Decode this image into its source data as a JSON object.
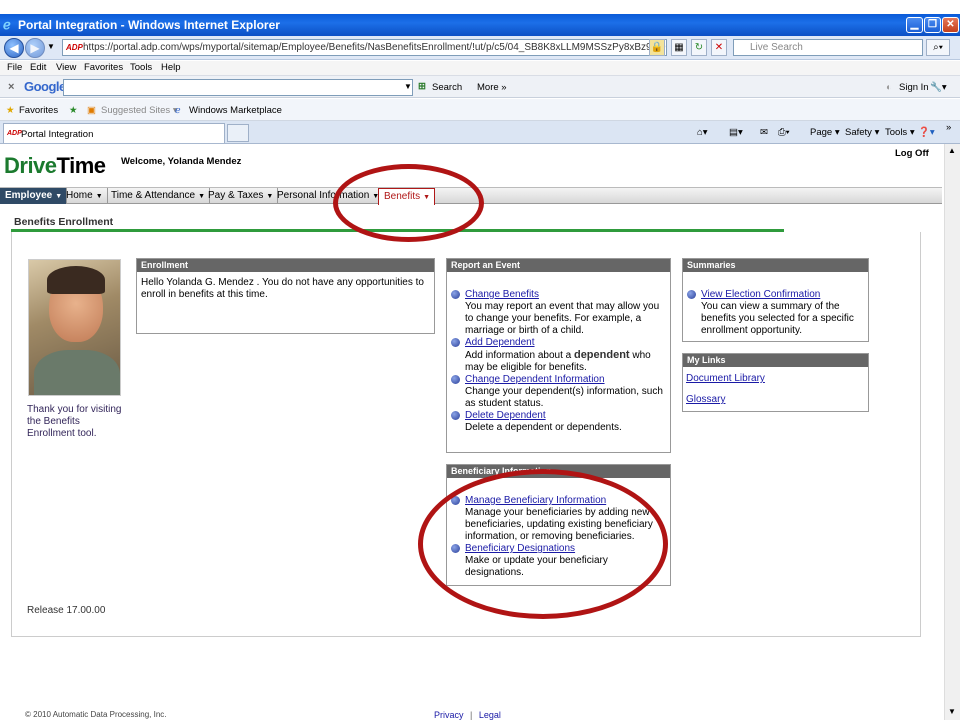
{
  "browser": {
    "title": "Portal Integration - Windows Internet Explorer",
    "url": "https://portal.adp.com/wps/myportal/sitemap/Employee/Benefits/NasBenefitsEnrollment/!ut/p/c5/04_SB8K8xLLM9MSSzPy8xBz9CP0os3hjA19HD_dgA3cL",
    "url_badge": "ADP",
    "live_search_placeholder": "Live Search",
    "menu": [
      "File",
      "Edit",
      "View",
      "Favorites",
      "Tools",
      "Help"
    ],
    "google": {
      "close": "×",
      "logo": "Google",
      "search_label": "Search",
      "more_label": "More »",
      "sign_in": "Sign In"
    },
    "favorites": {
      "label": "Favorites",
      "suggested": "Suggested Sites ▾",
      "marketplace": "Windows Marketplace"
    },
    "tab": {
      "label": "Portal Integration",
      "badge": "ADP"
    },
    "commands": {
      "page": "Page ▾",
      "safety": "Safety ▾",
      "tools": "Tools ▾"
    }
  },
  "portal": {
    "logo_a": "Drive",
    "logo_b": "Time",
    "welcome": "Welcome, Yolanda Mendez",
    "logoff": "Log Off",
    "nav": [
      {
        "label": "Employee"
      },
      {
        "label": "Home"
      },
      {
        "label": "Time & Attendance"
      },
      {
        "label": "Pay & Taxes"
      },
      {
        "label": "Personal Information"
      },
      {
        "label": "Benefits"
      }
    ],
    "page_title": "Benefits Enrollment",
    "thanks": "Thank you for visiting the Benefits Enrollment tool.",
    "release": "Release 17.00.00",
    "enrollment": {
      "header": "Enrollment",
      "text": "Hello Yolanda G. Mendez . You do not have any opportunities to enroll in benefits at this time."
    },
    "report_event": {
      "header": "Report an Event",
      "items": [
        {
          "link": "Change Benefits",
          "desc": "You may report an event that may allow you to change your benefits. For example, a marriage or birth of a child."
        },
        {
          "link": "Add Dependent",
          "desc_a": "Add information about a ",
          "desc_b": "dependent",
          "desc_c": " who may be eligible for benefits."
        },
        {
          "link": "Change Dependent Information",
          "desc": "Change your dependent(s) information, such as student status."
        },
        {
          "link": "Delete Dependent",
          "desc": "Delete a dependent or dependents."
        }
      ]
    },
    "beneficiary": {
      "header": "Beneficiary Information",
      "items": [
        {
          "link": "Manage Beneficiary Information",
          "desc": "Manage your beneficiaries by adding new beneficiaries, updating existing beneficiary information, or removing beneficiaries."
        },
        {
          "link": "Beneficiary Designations",
          "desc": "Make or update your beneficiary designations."
        }
      ]
    },
    "summaries": {
      "header": "Summaries",
      "link": "View Election Confirmation",
      "desc": "You can view a summary of the benefits you selected for a specific enrollment opportunity."
    },
    "my_links": {
      "header": "My Links",
      "items": [
        "Document Library",
        "Glossary"
      ]
    },
    "footer": {
      "copyright": "© 2010 Automatic Data Processing, Inc.",
      "privacy": "Privacy",
      "separator": "|",
      "legal": "Legal"
    }
  },
  "colors": {
    "accent_green": "#2f9b3c",
    "annotation_red": "#b01414",
    "nav_dark": "#2f4a66"
  }
}
